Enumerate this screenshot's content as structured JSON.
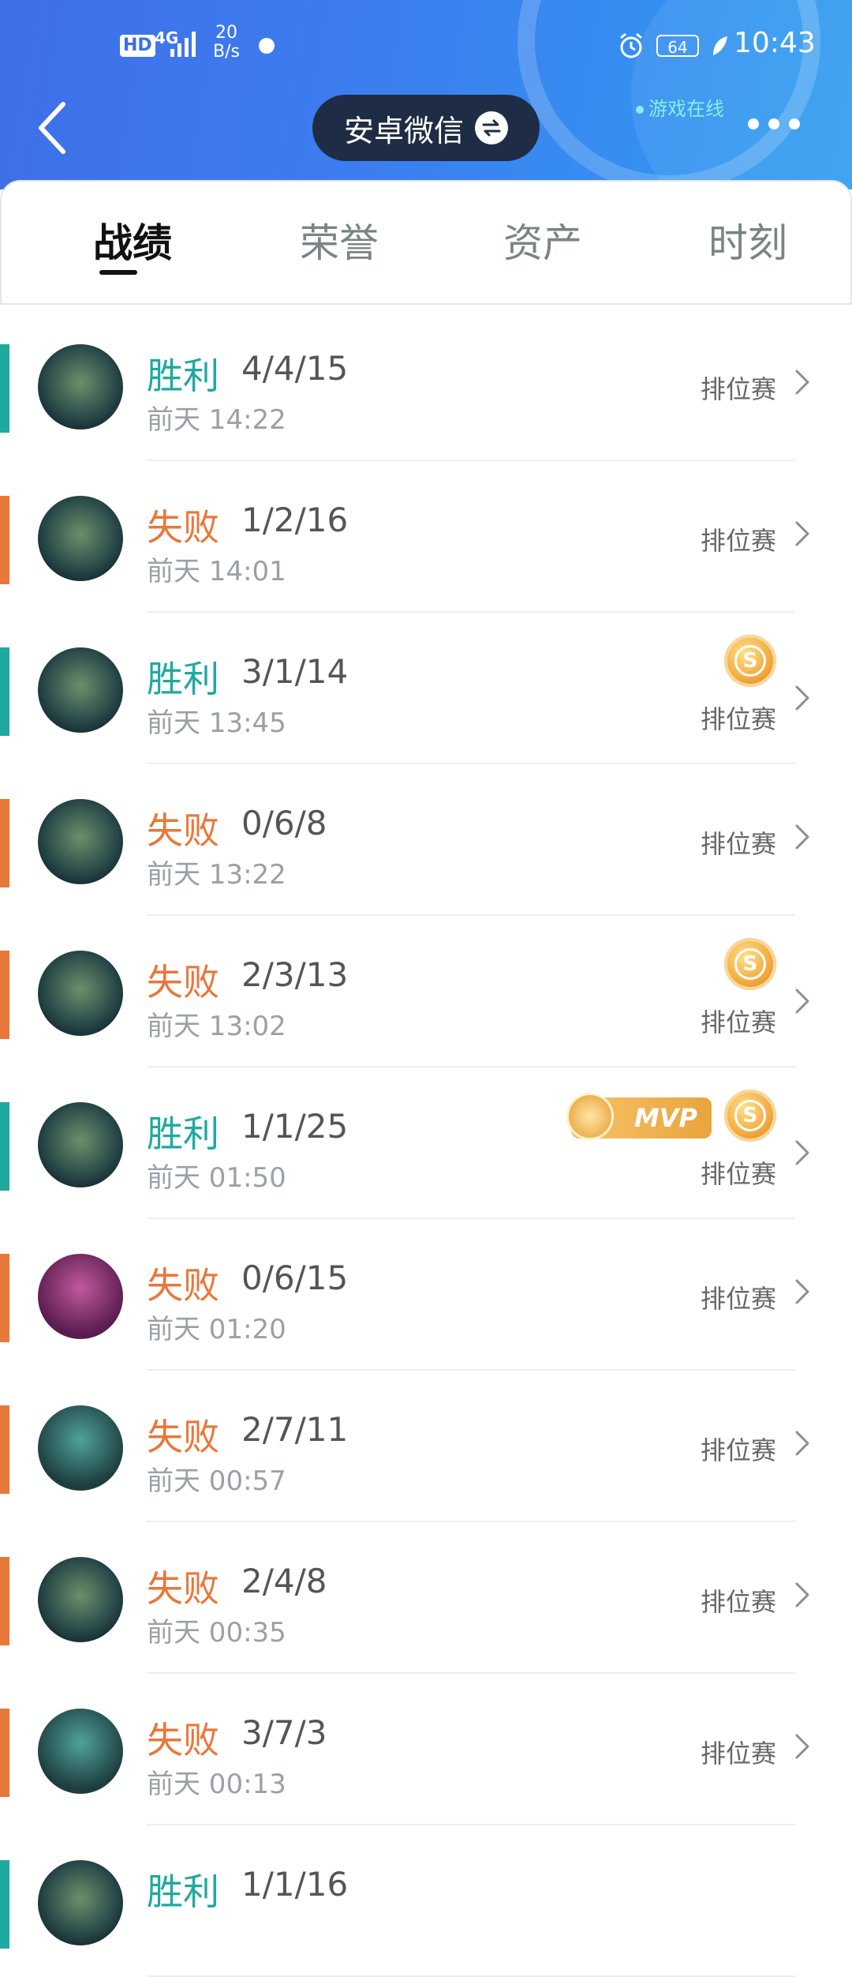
{
  "status_bar": {
    "hd": "HD",
    "signal": "4G",
    "net_speed_value": "20",
    "net_speed_unit": "B/s",
    "battery": "64",
    "time": "10:43"
  },
  "header": {
    "account_name": "安卓微信",
    "online_status": "游戏在线"
  },
  "tabs": [
    {
      "label": "战绩",
      "active": true
    },
    {
      "label": "荣誉",
      "active": false
    },
    {
      "label": "资产",
      "active": false
    },
    {
      "label": "时刻",
      "active": false
    }
  ],
  "colors": {
    "win": "#1fa9a0",
    "loss": "#e8773a"
  },
  "matches": [
    {
      "result": "胜利",
      "kda": "4/4/15",
      "time": "前天 14:22",
      "mode": "排位赛",
      "s_badge": false,
      "mvp": false
    },
    {
      "result": "失败",
      "kda": "1/2/16",
      "time": "前天 14:01",
      "mode": "排位赛",
      "s_badge": false,
      "mvp": false
    },
    {
      "result": "胜利",
      "kda": "3/1/14",
      "time": "前天 13:45",
      "mode": "排位赛",
      "s_badge": true,
      "mvp": false
    },
    {
      "result": "失败",
      "kda": "0/6/8",
      "time": "前天 13:22",
      "mode": "排位赛",
      "s_badge": false,
      "mvp": false
    },
    {
      "result": "失败",
      "kda": "2/3/13",
      "time": "前天 13:02",
      "mode": "排位赛",
      "s_badge": true,
      "mvp": false
    },
    {
      "result": "胜利",
      "kda": "1/1/25",
      "time": "前天 01:50",
      "mode": "排位赛",
      "s_badge": true,
      "mvp": true
    },
    {
      "result": "失败",
      "kda": "0/6/15",
      "time": "前天 01:20",
      "mode": "排位赛",
      "s_badge": false,
      "mvp": false
    },
    {
      "result": "失败",
      "kda": "2/7/11",
      "time": "前天 00:57",
      "mode": "排位赛",
      "s_badge": false,
      "mvp": false
    },
    {
      "result": "失败",
      "kda": "2/4/8",
      "time": "前天 00:35",
      "mode": "排位赛",
      "s_badge": false,
      "mvp": false
    },
    {
      "result": "失败",
      "kda": "3/7/3",
      "time": "前天 00:13",
      "mode": "排位赛",
      "s_badge": false,
      "mvp": false
    },
    {
      "result": "胜利",
      "kda": "1/1/16",
      "time": "",
      "mode": "",
      "s_badge": false,
      "mvp": false
    }
  ],
  "badges": {
    "s_label": "S",
    "mvp_label": "MVP"
  }
}
